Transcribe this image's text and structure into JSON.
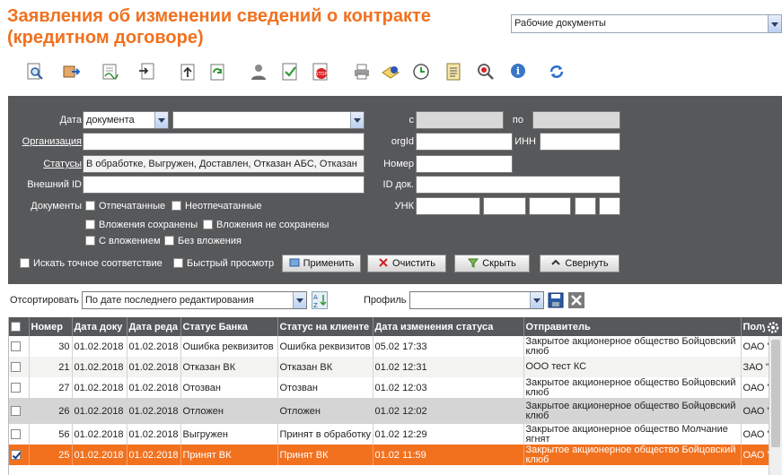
{
  "header": {
    "title": "Заявления об изменении сведений о контракте (кредитном договоре)",
    "doc_select": "Рабочие документы"
  },
  "toolbar": {
    "icons": [
      "view-icon",
      "export-icon",
      "sign-icon",
      "import-icon",
      "upload-icon",
      "refresh-status-icon",
      "user-icon",
      "check-icon",
      "stop-icon",
      "print-icon",
      "seal-icon",
      "history-icon",
      "log-icon",
      "search-error-icon",
      "info-icon",
      "reload-icon"
    ]
  },
  "filter": {
    "date_label": "Дата",
    "date_type": "документа",
    "date_value": "",
    "from_label": "с",
    "to_label": "по",
    "org_label": "Организация",
    "org_value": "",
    "orgid_label": "orgId",
    "inn_label": "ИНН",
    "status_label": "Статусы",
    "status_value": "В обработке, Выгружен, Доставлен, Отказан АБС, Отказан",
    "number_label": "Номер",
    "extid_label": "Внешний ID",
    "docid_label": "ID док.",
    "docs_label": "Документы",
    "printed": "Отпечатанные",
    "not_printed": "Неотпечатанные",
    "unk_label": "УНК",
    "att_saved": "Вложения сохранены",
    "att_not_saved": "Вложения не сохранены",
    "with_att": "С вложением",
    "without_att": "Без вложения",
    "exact_match": "Искать точное соответствие",
    "quick_view": "Быстрый просмотр",
    "apply": "Применить",
    "clear": "Очистить",
    "hide": "Скрыть",
    "collapse": "Свернуть"
  },
  "sort": {
    "label": "Отсортировать",
    "value": "По дате последнего редактирования",
    "profile_label": "Профиль",
    "profile_value": ""
  },
  "table": {
    "columns": [
      "Номер",
      "Дата доку",
      "Дата реда",
      "Статус Банка",
      "Статус на клиенте",
      "Дата изменения статуса",
      "Отправитель",
      "Полу"
    ],
    "rows": [
      {
        "checked": false,
        "num": "30",
        "d1": "01.02.2018",
        "d2": "01.02.2018",
        "bank": "Ошибка реквизитов",
        "client": "Ошибка реквизитов",
        "changed": "05.02 17:33",
        "sender": "Закрытое акционерное общество Бойцовский клюб",
        "recv": "ОАО \""
      },
      {
        "checked": false,
        "num": "21",
        "d1": "01.02.2018",
        "d2": "01.02.2018",
        "bank": "Отказан ВК",
        "client": "Отказан ВК",
        "changed": "01.02 12:31",
        "sender": "ООО тест КС",
        "recv": "ЗАО \""
      },
      {
        "checked": false,
        "num": "27",
        "d1": "01.02.2018",
        "d2": "01.02.2018",
        "bank": "Отозван",
        "client": "Отозван",
        "changed": "01.02 12:03",
        "sender": "Закрытое акционерное общество Бойцовский клюб",
        "recv": "ОАО \""
      },
      {
        "checked": false,
        "num": "26",
        "d1": "01.02.2018",
        "d2": "01.02.2018",
        "bank": "Отложен",
        "client": "Отложен",
        "changed": "01.02 12:02",
        "sender": "Закрытое акционерное общество Бойцовский клюб",
        "recv": "ОАО \""
      },
      {
        "checked": false,
        "num": "56",
        "d1": "01.02.2018",
        "d2": "01.02.2018",
        "bank": "Выгружен",
        "client": "Принят в обработку",
        "changed": "01.02 12:29",
        "sender": "Закрытое акционерное общество Молчание ягнят",
        "recv": "ОАО \""
      },
      {
        "checked": true,
        "num": "25",
        "d1": "01.02.2018",
        "d2": "01.02.2018",
        "bank": "Принят ВК",
        "client": "Принят ВК",
        "changed": "01.02 11:59",
        "sender": "Закрытое акционерное общество Бойцовский клюб",
        "recv": "ОАО \""
      }
    ]
  }
}
